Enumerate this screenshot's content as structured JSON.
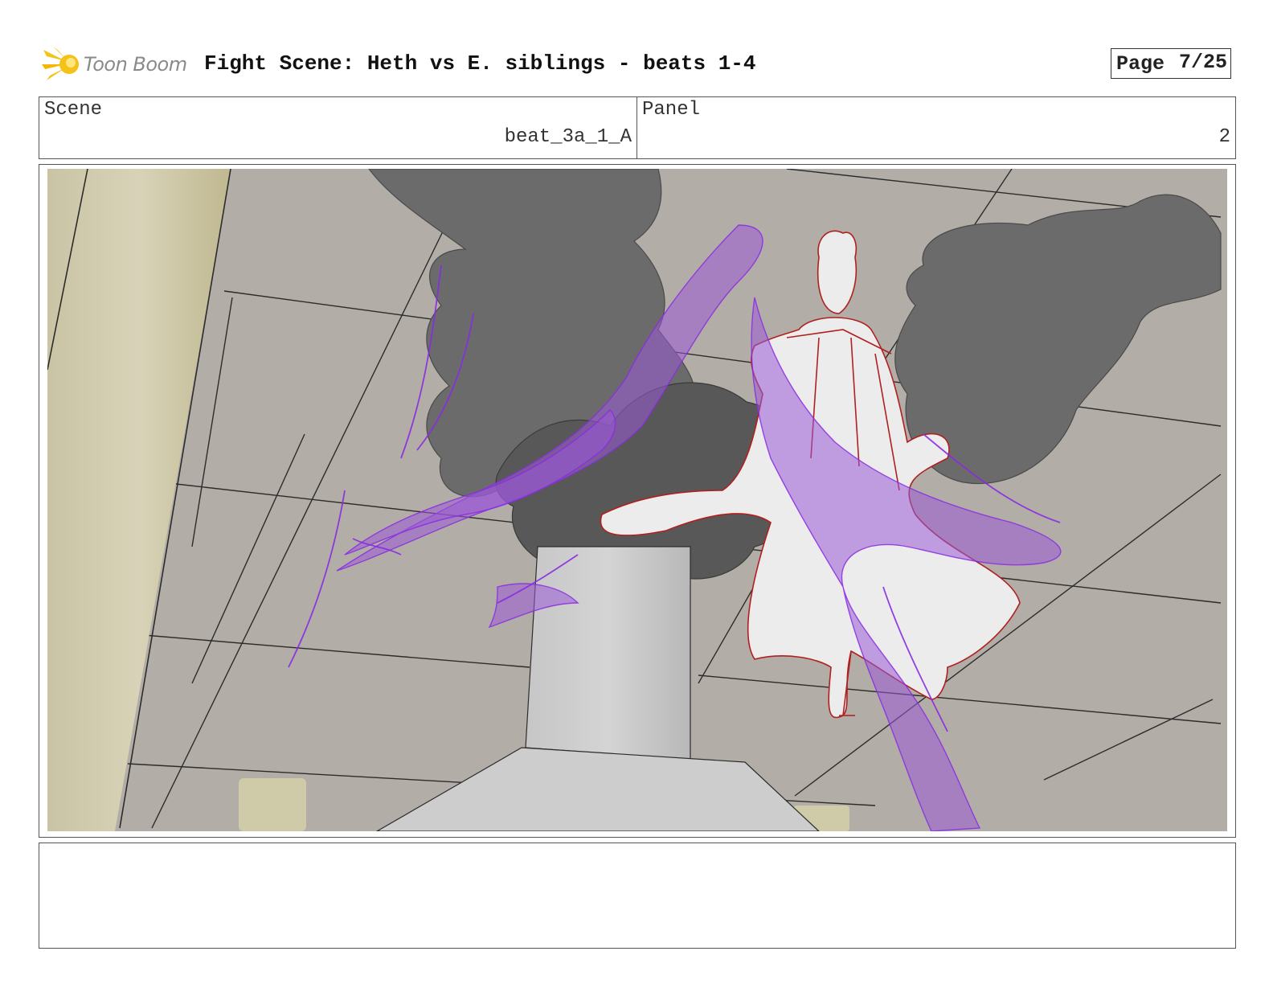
{
  "header": {
    "logo_text": "Toon Boom",
    "title": "Fight Scene: Heth vs E. siblings - beats 1-4",
    "page_label": "Page",
    "page_number": "7/25"
  },
  "info": {
    "scene_label": "Scene",
    "scene_value": "beat_3a_1_A",
    "panel_label": "Panel",
    "panel_value": "2"
  },
  "notes": {
    "text": ""
  },
  "colors": {
    "logo_accent": "#f5c21a",
    "ceiling": "#b2ada6",
    "smoke": "#6b6b6b",
    "magic": "#9b59d6",
    "character_line": "#b02020"
  },
  "icons": [
    "toon-boom-logo-icon"
  ]
}
